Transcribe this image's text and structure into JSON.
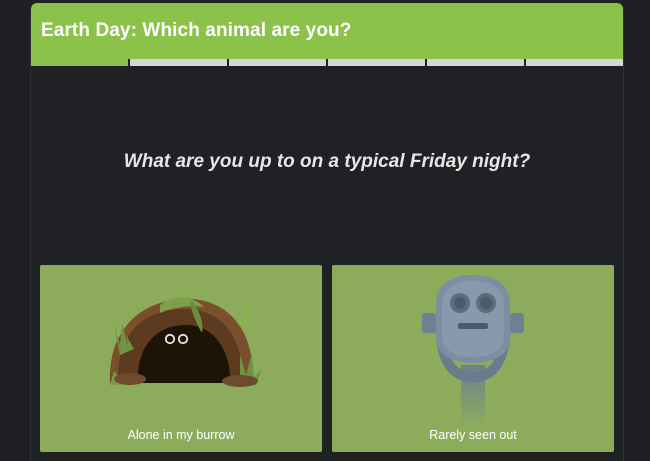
{
  "quiz": {
    "title": "Earth Day: Which animal are you?",
    "progress": {
      "total_steps": 6,
      "completed_steps": 1
    },
    "question": "What are you up to on a typical Friday night?",
    "answers": [
      {
        "label": "Alone in my burrow",
        "icon": "burrow-icon"
      },
      {
        "label": "Rarely seen out",
        "icon": "binoculars-viewer-icon"
      }
    ]
  },
  "colors": {
    "accent": "#8bc34a",
    "card": "#8cac5c",
    "background": "#202125",
    "progress_empty": "#d6d6d6"
  }
}
